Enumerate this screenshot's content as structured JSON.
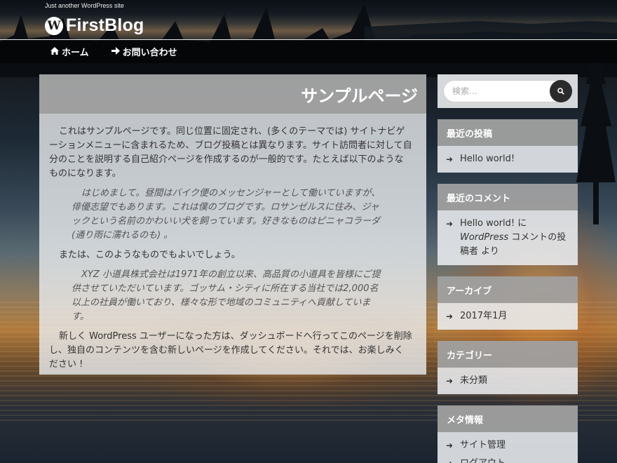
{
  "header": {
    "tagline": "Just another WordPress site",
    "site_title": "FirstBlog",
    "logo_glyph": "W"
  },
  "nav": {
    "items": [
      {
        "label": "ホーム",
        "icon": "home-icon"
      },
      {
        "label": "お問い合わせ",
        "icon": "arrow-right-icon"
      }
    ]
  },
  "main": {
    "page_title": "サンプルページ",
    "paragraphs": {
      "p1": "これはサンプルページです。同じ位置に固定され、(多くのテーマでは) サイトナビゲーションメニューに含まれるため、ブログ投稿とは異なります。サイト訪問者に対して自分のことを説明する自己紹介ページを作成するのが一般的です。たとえば以下のようなものになります。",
      "q1": "はじめまして。昼間はバイク便のメッセンジャーとして働いていますが、俳優志望でもあります。これは僕のブログです。ロサンゼルスに住み、ジャックという名前のかわいい犬を飼っています。好きなものはピニャコラーダ (通り雨に濡れるのも) 。",
      "p2": "または、このようなものでもよいでしょう。",
      "q2": "XYZ 小道具株式会社は1971年の創立以来、高品質の小道具を皆様にご提供させていただいています。ゴッサム・シティに所在する当社では2,000名以上の社員が働いており、様々な形で地域のコミュニティへ貢献しています。",
      "p3": "新しく WordPress ユーザーになった方は、ダッシュボードへ行ってこのページを削除し、独自のコンテンツを含む新しいページを作成してください。それでは、お楽しみください !"
    }
  },
  "sidebar": {
    "search": {
      "placeholder": "検索…",
      "button_icon": "search-icon"
    },
    "recent_posts": {
      "title": "最近の投稿",
      "items": [
        "Hello world!"
      ]
    },
    "recent_comments": {
      "title": "最近のコメント",
      "item": {
        "post": "Hello world!",
        "connector": " に ",
        "author": "WordPress",
        "suffix": " コメントの投稿者 より"
      }
    },
    "archives": {
      "title": "アーカイブ",
      "items": [
        "2017年1月"
      ]
    },
    "categories": {
      "title": "カテゴリー",
      "items": [
        "未分類"
      ]
    },
    "meta": {
      "title": "メタ情報",
      "items": [
        "サイト管理",
        "ログアウト"
      ]
    }
  },
  "colors": {
    "widget_title_bg": "#a0a0a0",
    "panel_bg": "#ebedf0",
    "search_button": "#2b2b2b"
  }
}
